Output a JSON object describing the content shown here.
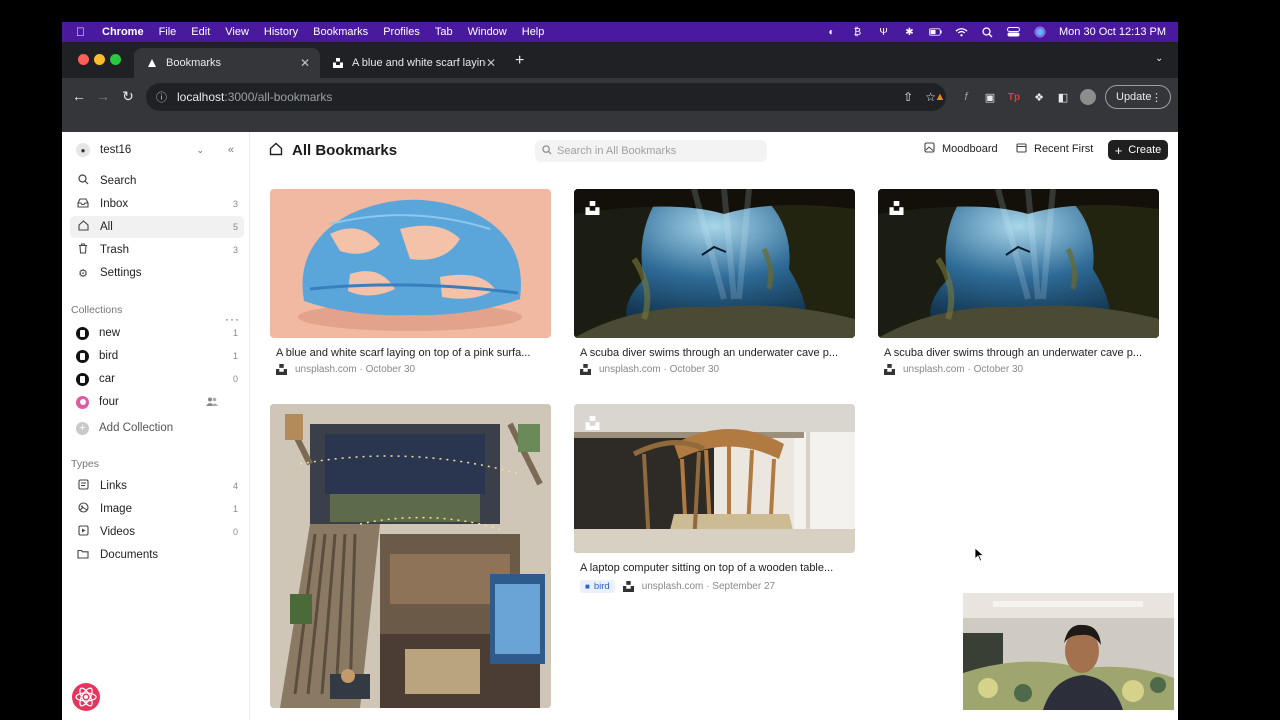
{
  "menubar": {
    "app_name": "Chrome",
    "items": [
      "File",
      "Edit",
      "View",
      "History",
      "Bookmarks",
      "Profiles",
      "Tab",
      "Window",
      "Help"
    ],
    "datetime": "Mon 30 Oct  12:13 PM"
  },
  "browser": {
    "tabs": [
      {
        "title": "Bookmarks"
      },
      {
        "title": "A blue and white scarf laying o"
      }
    ],
    "url_host": "localhost",
    "url_path": ":3000/all-bookmarks",
    "update_label": "Update"
  },
  "sidebar": {
    "username": "test16",
    "nav": [
      {
        "label": "Search",
        "icon": "search-icon",
        "count": ""
      },
      {
        "label": "Inbox",
        "icon": "inbox-icon",
        "count": "3"
      },
      {
        "label": "All",
        "icon": "home-icon",
        "count": "5"
      },
      {
        "label": "Trash",
        "icon": "trash-icon",
        "count": "3"
      },
      {
        "label": "Settings",
        "icon": "gear-icon",
        "count": ""
      }
    ],
    "collections_title": "Collections",
    "collections": [
      {
        "label": "new",
        "count": "1"
      },
      {
        "label": "bird",
        "count": "1"
      },
      {
        "label": "car",
        "count": "0"
      },
      {
        "label": "four",
        "count": ""
      }
    ],
    "add_collection": "Add Collection",
    "types_title": "Types",
    "types": [
      {
        "label": "Links",
        "icon": "link-icon",
        "count": "4"
      },
      {
        "label": "Image",
        "icon": "image-icon",
        "count": "1"
      },
      {
        "label": "Videos",
        "icon": "video-icon",
        "count": "0"
      },
      {
        "label": "Documents",
        "icon": "folder-icon",
        "count": ""
      }
    ]
  },
  "main": {
    "title": "All Bookmarks",
    "search_placeholder": "Search in All Bookmarks",
    "moodboard_label": "Moodboard",
    "sort_label": "Recent First",
    "create_label": "Create",
    "cards": [
      {
        "title": "A blue and white scarf laying on top of a pink surfa...",
        "source": "unsplash.com",
        "date": "October 30",
        "tag": ""
      },
      {
        "title": "A scuba diver swims through an underwater cave p...",
        "source": "unsplash.com",
        "date": "October 30",
        "tag": ""
      },
      {
        "title": "A scuba diver swims through an underwater cave p...",
        "source": "unsplash.com",
        "date": "October 30",
        "tag": ""
      },
      {
        "title": "",
        "source": "",
        "date": "",
        "tag": ""
      },
      {
        "title": "A laptop computer sitting on top of a wooden table...",
        "source": "unsplash.com",
        "date": "September 27",
        "tag": "bird"
      }
    ]
  },
  "colors": {
    "menubar_bg": "#4a1a9e",
    "chrome_bg": "#202124",
    "toolbar_bg": "#35363a",
    "tag_bg": "#eaf1fd",
    "tag_fg": "#2a62c9"
  }
}
